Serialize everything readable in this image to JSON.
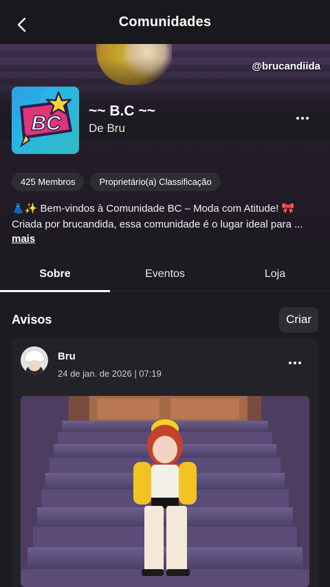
{
  "header": {
    "title": "Comunidades",
    "back_icon": "chevron-left-icon"
  },
  "banner": {
    "watermark": "@brucandiida"
  },
  "community": {
    "logo_text": "BC",
    "name": "~~ B.C ~~",
    "owner": "De Bru",
    "more_icon": "ellipsis-icon",
    "chips": [
      "425 Membros",
      "Proprietário(a) Classificação"
    ],
    "description_lines": [
      "👗✨ Bem-vindos à Comunidade BC – Moda com Atitude! 🎀",
      "Criada por brucandida, essa comunidade é o lugar ideal para ..."
    ],
    "more_link": "mais"
  },
  "tabs": [
    {
      "label": "Sobre",
      "active": true
    },
    {
      "label": "Eventos",
      "active": false
    },
    {
      "label": "Loja",
      "active": false
    }
  ],
  "announcements": {
    "title": "Avisos",
    "create_label": "Criar",
    "post": {
      "author": "Bru",
      "date": "24 de jan. de 2026 | 07:19",
      "more_icon": "ellipsis-icon"
    }
  },
  "colors": {
    "background": "#1c1b20",
    "surface": "#2e2d33",
    "card": "#232228",
    "logo_gradient_start": "#2e9de5",
    "logo_gradient_end": "#34c4a0",
    "logo_badge": "#e0357a"
  }
}
